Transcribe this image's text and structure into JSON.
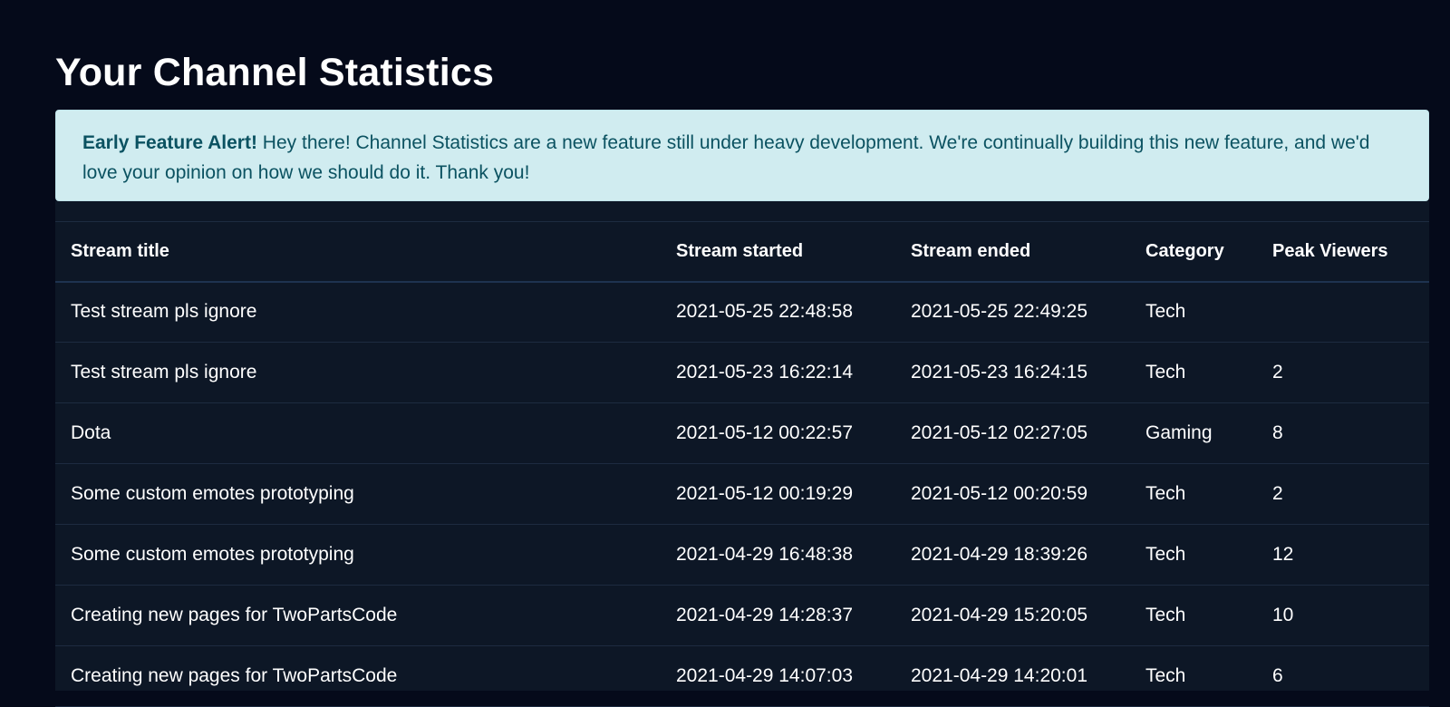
{
  "page": {
    "title": "Your Channel Statistics"
  },
  "alert": {
    "strong": "Early Feature Alert!",
    "message": " Hey there! Channel Statistics are a new feature still under heavy development. We're continually building this new feature, and we'd love your opinion on how we should do it. Thank you!"
  },
  "table": {
    "headers": [
      "Stream title",
      "Stream started",
      "Stream ended",
      "Category",
      "Peak Viewers"
    ],
    "rows": [
      [
        "Test stream pls ignore",
        "2021-05-25 22:48:58",
        "2021-05-25 22:49:25",
        "Tech",
        ""
      ],
      [
        "Test stream pls ignore",
        "2021-05-23 16:22:14",
        "2021-05-23 16:24:15",
        "Tech",
        "2"
      ],
      [
        "Dota",
        "2021-05-12 00:22:57",
        "2021-05-12 02:27:05",
        "Gaming",
        "8"
      ],
      [
        "Some custom emotes prototyping",
        "2021-05-12 00:19:29",
        "2021-05-12 00:20:59",
        "Tech",
        "2"
      ],
      [
        "Some custom emotes prototyping",
        "2021-04-29 16:48:38",
        "2021-04-29 18:39:26",
        "Tech",
        "12"
      ],
      [
        "Creating new pages for TwoPartsCode",
        "2021-04-29 14:28:37",
        "2021-04-29 15:20:05",
        "Tech",
        "10"
      ],
      [
        "Creating new pages for TwoPartsCode",
        "2021-04-29 14:07:03",
        "2021-04-29 14:20:01",
        "Tech",
        "6"
      ]
    ]
  },
  "colors": {
    "background": "#050a1a",
    "table_background": "#0d1726",
    "alert_background": "#d0ecf0",
    "alert_text": "#0b5261"
  }
}
